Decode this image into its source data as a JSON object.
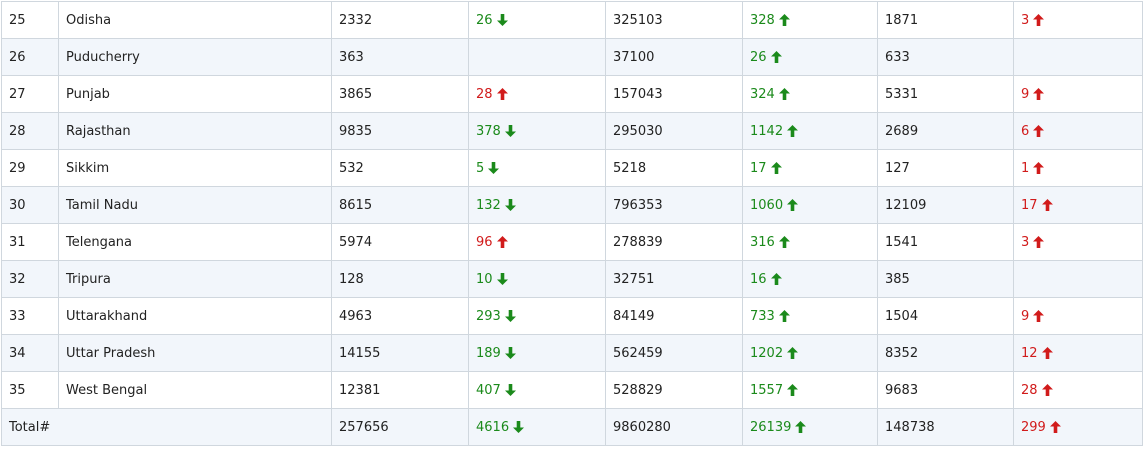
{
  "colors": {
    "decrease": "#1b8a1b",
    "increase": "#d11b1b",
    "stripe": "#f2f6fb",
    "border": "#d0d7de"
  },
  "rows": [
    {
      "sno": "25",
      "state": "Odisha",
      "active": "2332",
      "active_change": "26",
      "active_dir": "down",
      "cured": "325103",
      "cured_change": "328",
      "cured_dir": "up",
      "deaths": "1871",
      "deaths_change": "3",
      "deaths_dir": "up"
    },
    {
      "sno": "26",
      "state": "Puducherry",
      "active": "363",
      "active_change": "",
      "active_dir": "",
      "cured": "37100",
      "cured_change": "26",
      "cured_dir": "up",
      "deaths": "633",
      "deaths_change": "",
      "deaths_dir": ""
    },
    {
      "sno": "27",
      "state": "Punjab",
      "active": "3865",
      "active_change": "28",
      "active_dir": "up",
      "cured": "157043",
      "cured_change": "324",
      "cured_dir": "up",
      "deaths": "5331",
      "deaths_change": "9",
      "deaths_dir": "up"
    },
    {
      "sno": "28",
      "state": "Rajasthan",
      "active": "9835",
      "active_change": "378",
      "active_dir": "down",
      "cured": "295030",
      "cured_change": "1142",
      "cured_dir": "up",
      "deaths": "2689",
      "deaths_change": "6",
      "deaths_dir": "up"
    },
    {
      "sno": "29",
      "state": "Sikkim",
      "active": "532",
      "active_change": "5",
      "active_dir": "down",
      "cured": "5218",
      "cured_change": "17",
      "cured_dir": "up",
      "deaths": "127",
      "deaths_change": "1",
      "deaths_dir": "up"
    },
    {
      "sno": "30",
      "state": "Tamil Nadu",
      "active": "8615",
      "active_change": "132",
      "active_dir": "down",
      "cured": "796353",
      "cured_change": "1060",
      "cured_dir": "up",
      "deaths": "12109",
      "deaths_change": "17",
      "deaths_dir": "up"
    },
    {
      "sno": "31",
      "state": "Telengana",
      "active": "5974",
      "active_change": "96",
      "active_dir": "up",
      "cured": "278839",
      "cured_change": "316",
      "cured_dir": "up",
      "deaths": "1541",
      "deaths_change": "3",
      "deaths_dir": "up"
    },
    {
      "sno": "32",
      "state": "Tripura",
      "active": "128",
      "active_change": "10",
      "active_dir": "down",
      "cured": "32751",
      "cured_change": "16",
      "cured_dir": "up",
      "deaths": "385",
      "deaths_change": "",
      "deaths_dir": ""
    },
    {
      "sno": "33",
      "state": "Uttarakhand",
      "active": "4963",
      "active_change": "293",
      "active_dir": "down",
      "cured": "84149",
      "cured_change": "733",
      "cured_dir": "up",
      "deaths": "1504",
      "deaths_change": "9",
      "deaths_dir": "up"
    },
    {
      "sno": "34",
      "state": "Uttar Pradesh",
      "active": "14155",
      "active_change": "189",
      "active_dir": "down",
      "cured": "562459",
      "cured_change": "1202",
      "cured_dir": "up",
      "deaths": "8352",
      "deaths_change": "12",
      "deaths_dir": "up"
    },
    {
      "sno": "35",
      "state": "West Bengal",
      "active": "12381",
      "active_change": "407",
      "active_dir": "down",
      "cured": "528829",
      "cured_change": "1557",
      "cured_dir": "up",
      "deaths": "9683",
      "deaths_change": "28",
      "deaths_dir": "up"
    }
  ],
  "total": {
    "label": "Total#",
    "active": "257656",
    "active_change": "4616",
    "active_dir": "down",
    "cured": "9860280",
    "cured_change": "26139",
    "cured_dir": "up",
    "deaths": "148738",
    "deaths_change": "299",
    "deaths_dir": "up"
  }
}
